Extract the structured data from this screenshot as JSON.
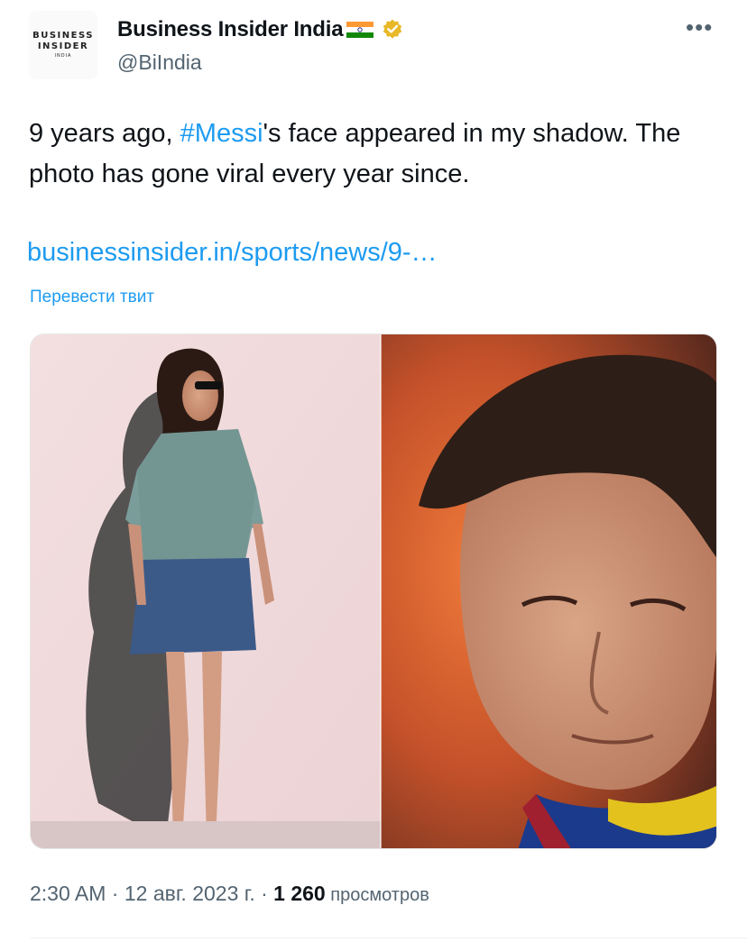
{
  "author": {
    "avatar": {
      "line1": "BUSINESS",
      "line2": "INSIDER",
      "line3": "INDIA"
    },
    "display_name": "Business Insider India",
    "flag_icon": "india-flag-icon",
    "verified_icon": "gold-verified-badge-icon",
    "handle": "@BiIndia"
  },
  "more_label": "•••",
  "tweet": {
    "text_before": "9 years ago, ",
    "hashtag": "#Messi",
    "text_after": "'s face appeared in my shadow. The photo has gone viral every year since.",
    "link": "businessinsider.in/sports/news/9-…",
    "translate": "Перевести твит"
  },
  "media": {
    "panels": [
      "woman-shadow-photo",
      "messi-face-photo"
    ]
  },
  "meta": {
    "time": "2:30 AM",
    "sep1": " · ",
    "date": "12 авг. 2023 г.",
    "sep2": " · ",
    "views_count": "1 260",
    "views_label": " просмотров"
  },
  "colors": {
    "accent": "#1d9bf0",
    "text": "#0f1419",
    "secondary": "#536471",
    "verified_gold": "#e8b829"
  }
}
